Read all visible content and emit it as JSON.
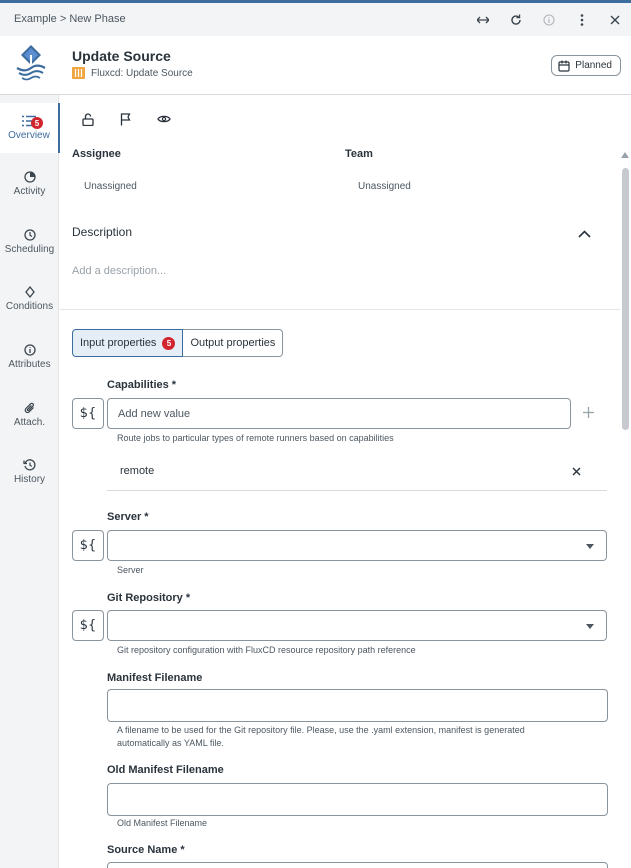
{
  "breadcrumb": {
    "root": "Example",
    "sep": ">",
    "current": "New Phase"
  },
  "topbar_icons": [
    "expand-horizontal-icon",
    "refresh-icon",
    "info-icon",
    "more-vertical-icon",
    "close-icon"
  ],
  "header": {
    "title": "Update Source",
    "subtitle": "Fluxcd: Update Source",
    "status": "Planned",
    "accent": "#3d6c9e",
    "subtitle_icon_color": "#f0a640"
  },
  "sidebar": {
    "items": [
      {
        "label": "Overview",
        "icon": "list-icon",
        "badge": "5",
        "active": true
      },
      {
        "label": "Activity",
        "icon": "pie-chart-icon"
      },
      {
        "label": "Scheduling",
        "icon": "clock-icon"
      },
      {
        "label": "Conditions",
        "icon": "diamond-icon"
      },
      {
        "label": "Attributes",
        "icon": "info-icon"
      },
      {
        "label": "Attach.",
        "icon": "paperclip-icon"
      },
      {
        "label": "History",
        "icon": "history-icon"
      }
    ]
  },
  "toolbar_icons": [
    "lock-icon",
    "flag-icon",
    "eye-icon"
  ],
  "assignee": {
    "label": "Assignee",
    "value": "Unassigned"
  },
  "team": {
    "label": "Team",
    "value": "Unassigned"
  },
  "description": {
    "label": "Description",
    "placeholder": "Add a description..."
  },
  "tabs": {
    "input": "Input properties",
    "input_count": "5",
    "output": "Output properties"
  },
  "fields": {
    "capabilities": {
      "label": "Capabilities *",
      "placeholder": "Add new value",
      "help": "Route jobs to particular types of remote runners based on capabilities",
      "values": [
        "remote"
      ]
    },
    "server": {
      "label": "Server *",
      "help": "Server"
    },
    "git_repository": {
      "label": "Git Repository *",
      "help": "Git repository configuration with FluxCD resource repository path reference"
    },
    "manifest_filename": {
      "label": "Manifest Filename",
      "help_line1": "A filename to be used for the Git repository file. Please, use the .yaml extension, manifest is generated",
      "help_line2": "automatically as YAML file."
    },
    "old_manifest_filename": {
      "label": "Old Manifest Filename",
      "help": "Old Manifest Filename"
    },
    "source_name": {
      "label": "Source Name *"
    }
  },
  "variable_button": "${"
}
